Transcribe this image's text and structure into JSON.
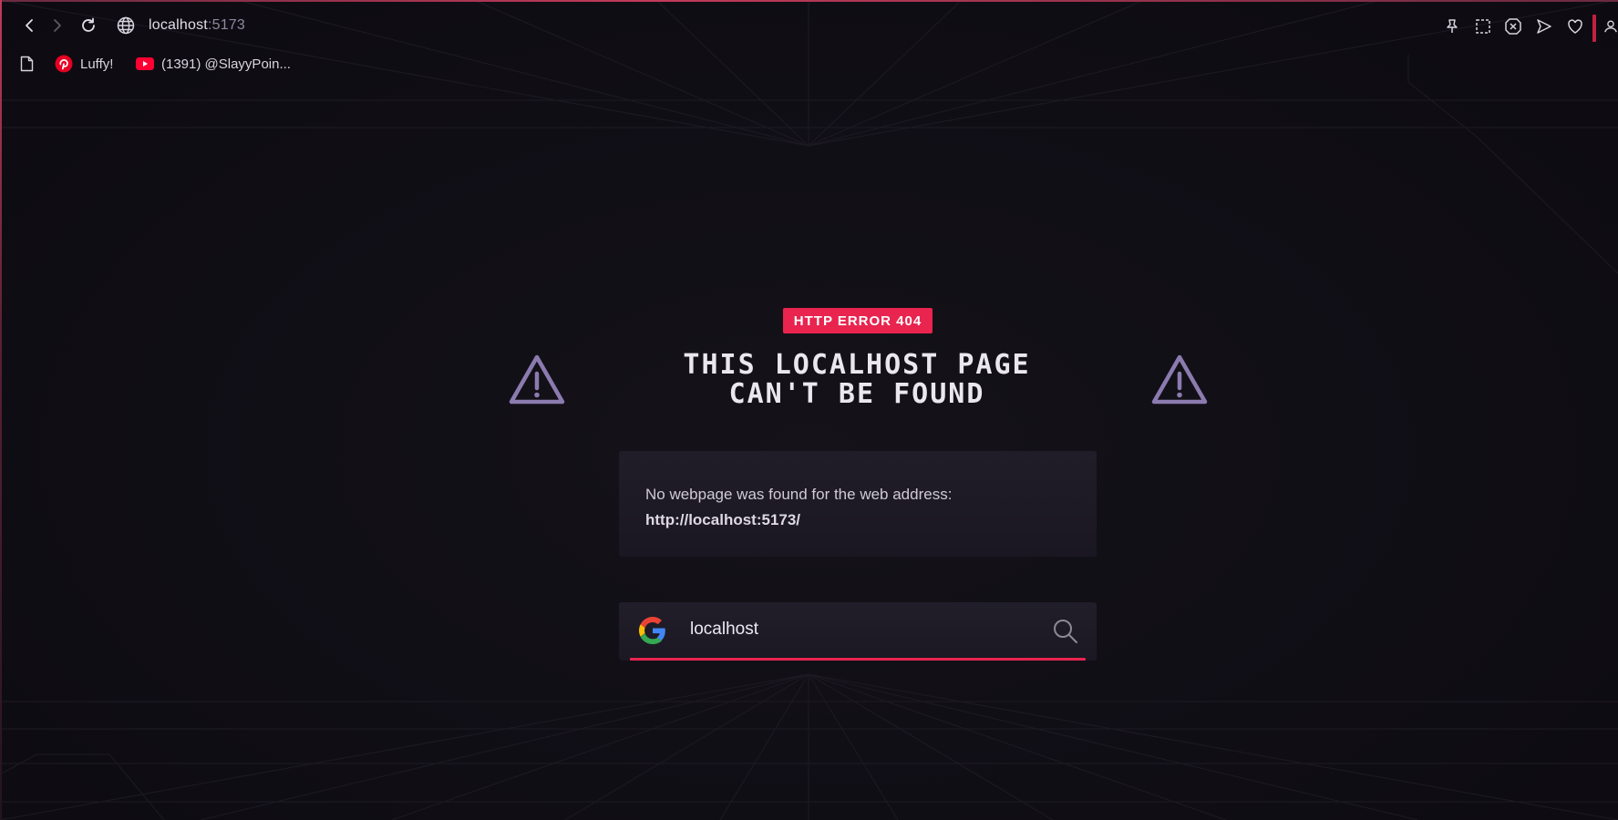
{
  "browser": {
    "address_host": "localhost",
    "address_port": ":5173",
    "accent_color": "#e8244f"
  },
  "toolbar": {
    "icons": [
      "back-icon",
      "forward-icon",
      "reload-icon",
      "globe-icon",
      "pin-icon",
      "snapshot-icon",
      "close-tab-icon",
      "send-icon",
      "heart-icon",
      "profile-icon"
    ]
  },
  "bookmarks": [
    {
      "icon": "pinterest-icon",
      "label": "Luffy!"
    },
    {
      "icon": "youtube-icon",
      "label": "(1391) @SlayyPoin..."
    }
  ],
  "error": {
    "badge": "HTTP ERROR 404",
    "title_line1": "THIS LOCALHOST PAGE",
    "title_line2": "CAN'T BE FOUND",
    "message": "No webpage was found for the web address:",
    "url": "http://localhost:5173/"
  },
  "search": {
    "value": "localhost",
    "engine_icon": "google-icon"
  }
}
